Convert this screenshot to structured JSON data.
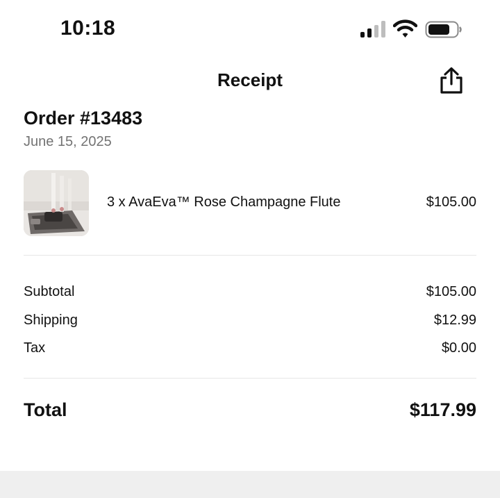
{
  "status_bar": {
    "time": "10:18",
    "icons": [
      "cellular-signal-icon",
      "wifi-icon",
      "battery-icon"
    ]
  },
  "nav": {
    "title": "Receipt",
    "share_icon": "share-icon"
  },
  "order": {
    "title": "Order #13483",
    "date": "June 15, 2025"
  },
  "items": [
    {
      "name": "3 x AvaEva™ Rose Champagne Flute",
      "price": "$105.00",
      "thumbnail": "champagne-flutes-photo"
    }
  ],
  "summary": {
    "subtotal_label": "Subtotal",
    "subtotal_value": "$105.00",
    "shipping_label": "Shipping",
    "shipping_value": "$12.99",
    "tax_label": "Tax",
    "tax_value": "$0.00",
    "total_label": "Total",
    "total_value": "$117.99"
  },
  "colors": {
    "text": "#111111",
    "muted_text": "#737373",
    "divider": "#e6e6e6",
    "bottom_band": "#efefef"
  }
}
